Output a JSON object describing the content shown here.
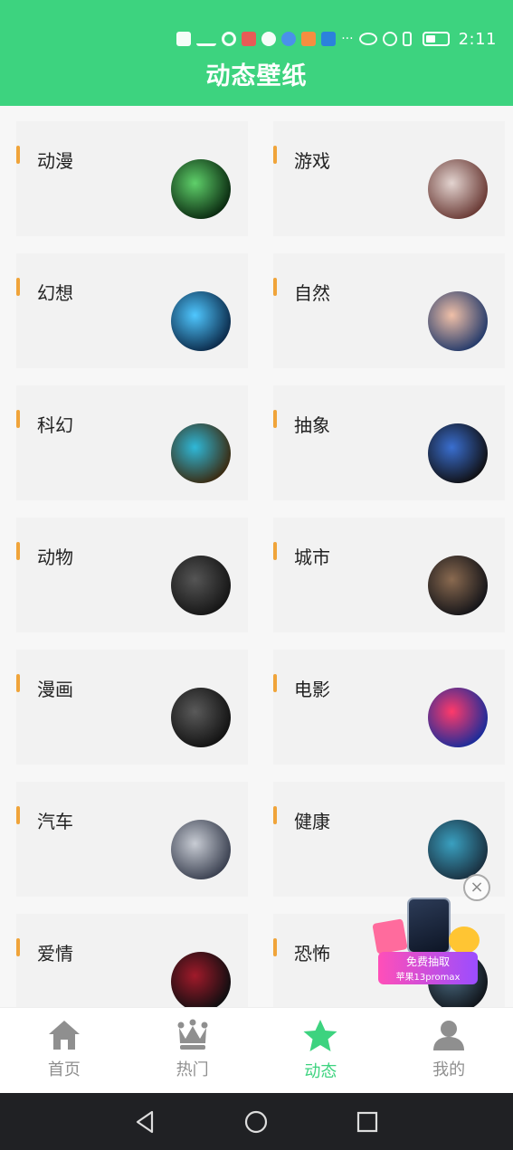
{
  "status": {
    "time": "2:11"
  },
  "header": {
    "title": "动态壁纸"
  },
  "categories": [
    {
      "label": "动漫",
      "colors": [
        "#5fd06a",
        "#0a2a10"
      ]
    },
    {
      "label": "游戏",
      "colors": [
        "#e3d4d0",
        "#6a3a35"
      ]
    },
    {
      "label": "幻想",
      "colors": [
        "#4fc7ff",
        "#0b2a4a"
      ]
    },
    {
      "label": "自然",
      "colors": [
        "#f0c0a8",
        "#243a6a"
      ]
    },
    {
      "label": "科幻",
      "colors": [
        "#2fb8d8",
        "#3a2a10"
      ]
    },
    {
      "label": "抽象",
      "colors": [
        "#3a6fd0",
        "#101014"
      ]
    },
    {
      "label": "动物",
      "colors": [
        "#555555",
        "#151515"
      ]
    },
    {
      "label": "城市",
      "colors": [
        "#8a6a50",
        "#141418"
      ]
    },
    {
      "label": "漫画",
      "colors": [
        "#5a5a5a",
        "#121212"
      ]
    },
    {
      "label": "电影",
      "colors": [
        "#ff3a6a",
        "#1a2c9a"
      ]
    },
    {
      "label": "汽车",
      "colors": [
        "#c8ccd4",
        "#3a4050"
      ]
    },
    {
      "label": "健康",
      "colors": [
        "#3aa0c0",
        "#1a3040"
      ]
    },
    {
      "label": "爱情",
      "colors": [
        "#a01a2a",
        "#0e0e10"
      ]
    },
    {
      "label": "恐怖",
      "colors": [
        "#4a6a80",
        "#10141a"
      ]
    }
  ],
  "ad": {
    "line1": "免费抽取",
    "line2": "苹果13promax",
    "close": "×"
  },
  "tabs": [
    {
      "label": "首页",
      "icon": "home-icon",
      "active": false
    },
    {
      "label": "热门",
      "icon": "crown-icon",
      "active": false
    },
    {
      "label": "动态",
      "icon": "star-icon",
      "active": true
    },
    {
      "label": "我的",
      "icon": "user-icon",
      "active": false
    }
  ],
  "colors": {
    "accent": "#3dd37f",
    "bar": "#f0a43a"
  }
}
